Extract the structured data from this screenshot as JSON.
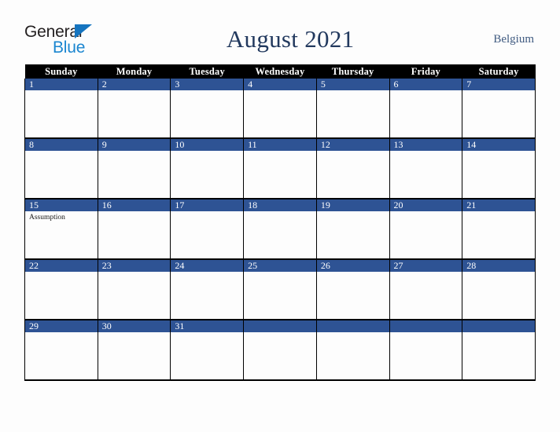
{
  "brand": {
    "name_top": "General",
    "name_bottom": "Blue",
    "triangle_icon": "triangle-icon",
    "color_top": "#231f20",
    "color_bottom": "#1b86d0",
    "triangle_color": "#1574bf"
  },
  "header": {
    "title": "August 2021",
    "locale": "Belgium",
    "title_color": "#22395e",
    "locale_color": "#3f5a80"
  },
  "calendar": {
    "month": "August",
    "year": "2021",
    "header_bg": "#000000",
    "header_text_color": "#ffffff",
    "daynum_bg": "#2e5394",
    "daynum_text_color": "#ffffff",
    "cell_bg": "#fdfdfd",
    "border_color": "#000000",
    "weekday_headers": [
      "Sunday",
      "Monday",
      "Tuesday",
      "Wednesday",
      "Thursday",
      "Friday",
      "Saturday"
    ],
    "weeks": [
      [
        {
          "day": "1",
          "events": []
        },
        {
          "day": "2",
          "events": []
        },
        {
          "day": "3",
          "events": []
        },
        {
          "day": "4",
          "events": []
        },
        {
          "day": "5",
          "events": []
        },
        {
          "day": "6",
          "events": []
        },
        {
          "day": "7",
          "events": []
        }
      ],
      [
        {
          "day": "8",
          "events": []
        },
        {
          "day": "9",
          "events": []
        },
        {
          "day": "10",
          "events": []
        },
        {
          "day": "11",
          "events": []
        },
        {
          "day": "12",
          "events": []
        },
        {
          "day": "13",
          "events": []
        },
        {
          "day": "14",
          "events": []
        }
      ],
      [
        {
          "day": "15",
          "events": [
            "Assumption"
          ]
        },
        {
          "day": "16",
          "events": []
        },
        {
          "day": "17",
          "events": []
        },
        {
          "day": "18",
          "events": []
        },
        {
          "day": "19",
          "events": []
        },
        {
          "day": "20",
          "events": []
        },
        {
          "day": "21",
          "events": []
        }
      ],
      [
        {
          "day": "22",
          "events": []
        },
        {
          "day": "23",
          "events": []
        },
        {
          "day": "24",
          "events": []
        },
        {
          "day": "25",
          "events": []
        },
        {
          "day": "26",
          "events": []
        },
        {
          "day": "27",
          "events": []
        },
        {
          "day": "28",
          "events": []
        }
      ],
      [
        {
          "day": "29",
          "events": []
        },
        {
          "day": "30",
          "events": []
        },
        {
          "day": "31",
          "events": []
        },
        {
          "day": "",
          "events": []
        },
        {
          "day": "",
          "events": []
        },
        {
          "day": "",
          "events": []
        },
        {
          "day": "",
          "events": []
        }
      ]
    ]
  }
}
